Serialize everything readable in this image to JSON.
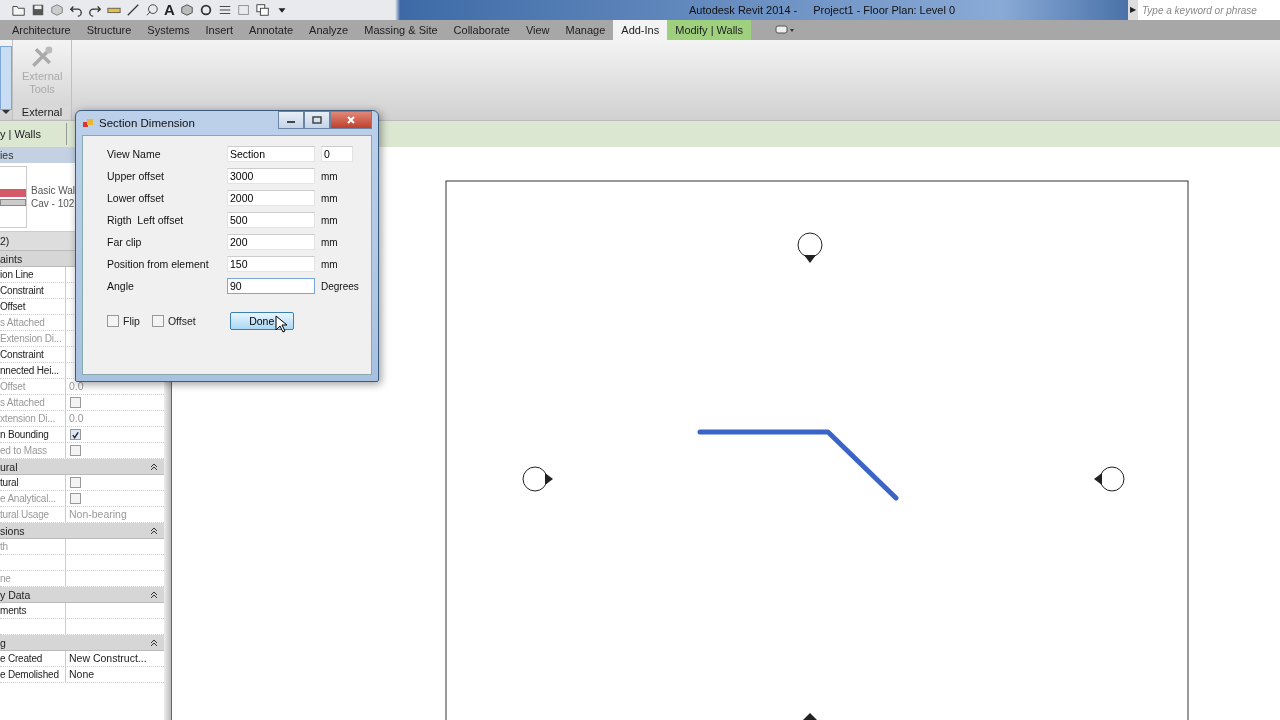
{
  "window": {
    "title": "Autodesk Revit 2014 -",
    "document": "Project1 - Floor Plan: Level 0",
    "text_tool_glyph": "A"
  },
  "search": {
    "arrow": "▶",
    "placeholder": "Type a keyword or phrase"
  },
  "tabs": [
    {
      "label": "Architecture",
      "selected": false,
      "contextual": false
    },
    {
      "label": "Structure",
      "selected": false,
      "contextual": false
    },
    {
      "label": "Systems",
      "selected": false,
      "contextual": false
    },
    {
      "label": "Insert",
      "selected": false,
      "contextual": false
    },
    {
      "label": "Annotate",
      "selected": false,
      "contextual": false
    },
    {
      "label": "Analyze",
      "selected": false,
      "contextual": false
    },
    {
      "label": "Massing & Site",
      "selected": false,
      "contextual": false
    },
    {
      "label": "Collaborate",
      "selected": false,
      "contextual": false
    },
    {
      "label": "View",
      "selected": false,
      "contextual": false
    },
    {
      "label": "Manage",
      "selected": false,
      "contextual": false
    },
    {
      "label": "Add-Ins",
      "selected": true,
      "contextual": false
    },
    {
      "label": "Modify | Walls",
      "selected": false,
      "contextual": true
    }
  ],
  "ribbon": {
    "tool": {
      "label": "External Tools",
      "disabled": true
    },
    "panel_label": "External"
  },
  "options_bar": {
    "context": "y | Walls"
  },
  "properties": {
    "title": "ies",
    "type_name": "Basic Wal",
    "type_detail": "Cav - 102",
    "instance_count": "2)",
    "rows": [
      {
        "kind": "group",
        "name": "aints"
      },
      {
        "kind": "text",
        "name": "ion Line",
        "disabled": false
      },
      {
        "kind": "text",
        "name": "Constraint",
        "disabled": false
      },
      {
        "kind": "text",
        "name": "Offset",
        "disabled": false
      },
      {
        "kind": "text",
        "name": "s Attached",
        "disabled": true
      },
      {
        "kind": "text",
        "name": "Extension Di...",
        "disabled": true
      },
      {
        "kind": "text",
        "name": "Constraint",
        "disabled": false
      },
      {
        "kind": "text",
        "name": "nnected Hei...",
        "disabled": false
      },
      {
        "kind": "text",
        "name": "Offset",
        "value": "0.0",
        "disabled": true
      },
      {
        "kind": "checkbox",
        "name": "s Attached",
        "checked": false,
        "disabled": true
      },
      {
        "kind": "text",
        "name": "xtension Di...",
        "value": "0.0",
        "disabled": true
      },
      {
        "kind": "checkbox",
        "name": "n Bounding",
        "checked": true,
        "disabled": false
      },
      {
        "kind": "checkbox",
        "name": "ed to Mass",
        "checked": false,
        "disabled": true
      },
      {
        "kind": "group",
        "name": "ural"
      },
      {
        "kind": "checkbox",
        "name": "tural",
        "checked": false,
        "disabled": false
      },
      {
        "kind": "checkbox",
        "name": "e Analytical...",
        "checked": false,
        "disabled": true
      },
      {
        "kind": "text",
        "name": "tural Usage",
        "value": "Non-bearing",
        "disabled": true
      },
      {
        "kind": "group",
        "name": "sions"
      },
      {
        "kind": "text",
        "name": "th",
        "disabled": true
      },
      {
        "kind": "text"
      },
      {
        "kind": "text",
        "name": "ne",
        "disabled": true
      },
      {
        "kind": "group",
        "name": "y Data"
      },
      {
        "kind": "text",
        "name": "ments",
        "disabled": false
      },
      {
        "kind": "text"
      },
      {
        "kind": "group",
        "name": "g"
      },
      {
        "kind": "text",
        "name": "e Created",
        "value": "New Construct...",
        "disabled": false
      },
      {
        "kind": "text",
        "name": "e Demolished",
        "value": "None",
        "disabled": false
      }
    ]
  },
  "dialog": {
    "title": "Section Dimension",
    "fields": [
      {
        "label": "View Name",
        "value": "Section",
        "extra_value": "0",
        "focused": false
      },
      {
        "label": "Upper offset",
        "value": "3000",
        "unit": "mm",
        "focused": false
      },
      {
        "label": "Lower offset",
        "value": "2000",
        "unit": "mm",
        "focused": false
      },
      {
        "label": "Rigth  Left offset",
        "value": "500",
        "unit": "mm",
        "focused": false
      },
      {
        "label": "Far clip",
        "value": "200",
        "unit": "mm",
        "focused": false
      },
      {
        "label": "Position from element",
        "value": "150",
        "unit": "mm",
        "focused": false
      },
      {
        "label": "Angle",
        "value": "90",
        "unit": "Degrees",
        "focused": true
      }
    ],
    "checkboxes": [
      {
        "label": "Flip",
        "checked": false
      },
      {
        "label": "Offset",
        "checked": false
      }
    ],
    "button": {
      "label": "Done",
      "hovered": true
    }
  }
}
